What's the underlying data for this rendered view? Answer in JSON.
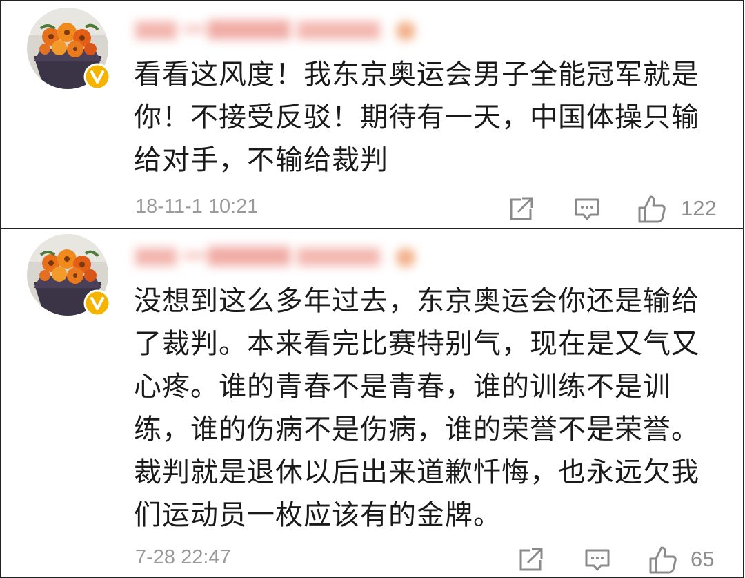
{
  "comments": [
    {
      "username": "",
      "verified_badge": "v",
      "text": "看看这风度！我东京奥运会男子全能冠军就是\n你！不接受反驳！期待有一天，中国体操只输\n给对手，不输给裁判",
      "time": "18-11-1 10:21",
      "likes": "122",
      "icons": [
        "share-icon",
        "comment-icon",
        "like-icon"
      ]
    },
    {
      "username": "",
      "verified_badge": "v",
      "text": "没想到这么多年过去，东京奥运会你还是输给\n了裁判。本来看完比赛特别气，现在是又气又\n心疼。谁的青春不是青春，谁的训练不是训\n练，谁的伤病不是伤病，谁的荣誉不是荣誉。\n裁判就是退休以后出来道歉忏悔，也永远欠我\n们运动员一枚应该有的金牌。",
      "time": "7-28 22:47",
      "likes": "65",
      "icons": [
        "share-icon",
        "comment-icon",
        "like-icon"
      ]
    }
  ],
  "colors": {
    "badge": "#f4b400",
    "time_text": "#9a9a9a",
    "icon_stroke": "#8a8a8a",
    "body_text": "#1a1a1a"
  }
}
